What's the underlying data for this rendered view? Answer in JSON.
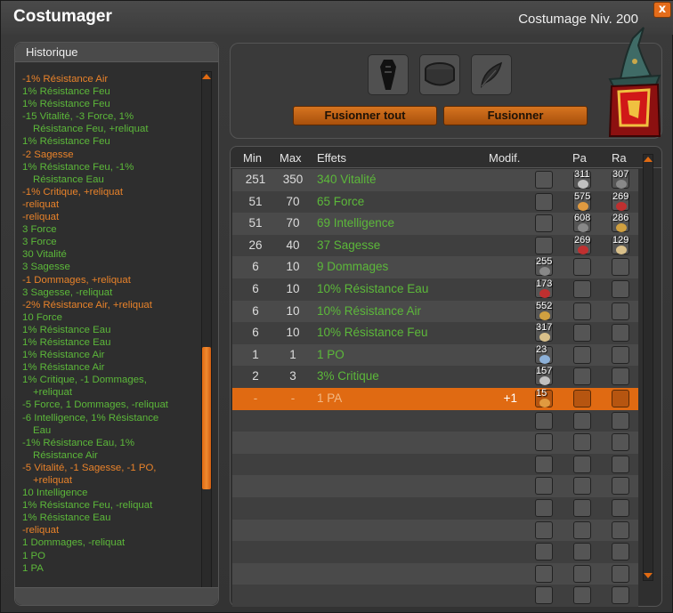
{
  "window": {
    "title": "Costumager",
    "subtitle": "Costumage Niv. 200",
    "close_label": "x"
  },
  "history": {
    "title": "Historique",
    "lines": [
      {
        "text": "-1% Résistance Air",
        "color": "orange"
      },
      {
        "text": "1% Résistance Feu",
        "color": "green"
      },
      {
        "text": "1% Résistance Feu",
        "color": "green"
      },
      {
        "text": "-15 Vitalité, -3 Force, 1%",
        "color": "green"
      },
      {
        "text": "Résistance Feu, +reliquat",
        "color": "green",
        "cont": true
      },
      {
        "text": "1% Résistance Feu",
        "color": "green"
      },
      {
        "text": "-2 Sagesse",
        "color": "orange"
      },
      {
        "text": "1% Résistance Feu, -1%",
        "color": "green"
      },
      {
        "text": "Résistance Eau",
        "color": "green",
        "cont": true
      },
      {
        "text": "-1% Critique, +reliquat",
        "color": "orange"
      },
      {
        "text": "-reliquat",
        "color": "orange"
      },
      {
        "text": "-reliquat",
        "color": "orange"
      },
      {
        "text": "3 Force",
        "color": "green"
      },
      {
        "text": "3 Force",
        "color": "green"
      },
      {
        "text": "30 Vitalité",
        "color": "green"
      },
      {
        "text": "3 Sagesse",
        "color": "green"
      },
      {
        "text": "-1 Dommages, +reliquat",
        "color": "orange"
      },
      {
        "text": "3 Sagesse, -reliquat",
        "color": "green"
      },
      {
        "text": "-2% Résistance Air, +reliquat",
        "color": "orange"
      },
      {
        "text": "10 Force",
        "color": "green"
      },
      {
        "text": "1% Résistance Eau",
        "color": "green"
      },
      {
        "text": "1% Résistance Eau",
        "color": "green"
      },
      {
        "text": "1% Résistance Air",
        "color": "green"
      },
      {
        "text": "1% Résistance Air",
        "color": "green"
      },
      {
        "text": "1% Critique, -1 Dommages,",
        "color": "green"
      },
      {
        "text": "+reliquat",
        "color": "green",
        "cont": true
      },
      {
        "text": "-5 Force, 1 Dommages, -reliquat",
        "color": "green"
      },
      {
        "text": "-6 Intelligence, 1% Résistance",
        "color": "green"
      },
      {
        "text": "Eau",
        "color": "green",
        "cont": true
      },
      {
        "text": "-1% Résistance Eau, 1%",
        "color": "green"
      },
      {
        "text": "Résistance Air",
        "color": "green",
        "cont": true
      },
      {
        "text": "-5 Vitalité, -1 Sagesse, -1 PO,",
        "color": "orange"
      },
      {
        "text": "+reliquat",
        "color": "orange",
        "cont": true
      },
      {
        "text": "10 Intelligence",
        "color": "green"
      },
      {
        "text": "1% Résistance Feu, -reliquat",
        "color": "green"
      },
      {
        "text": "1% Résistance Eau",
        "color": "green"
      },
      {
        "text": "-reliquat",
        "color": "orange"
      },
      {
        "text": "1 Dommages, -reliquat",
        "color": "green"
      },
      {
        "text": "1 PO",
        "color": "green"
      },
      {
        "text": "1 PA",
        "color": "green"
      }
    ],
    "scroll_fraction": 0.72
  },
  "fusion": {
    "slots": [
      "mask-icon",
      "rune-box-icon",
      "feather-icon"
    ],
    "fuse_all_label": "Fusionner tout",
    "fuse_label": "Fusionner"
  },
  "table": {
    "headers": {
      "min": "Min",
      "max": "Max",
      "effects": "Effets",
      "modif": "Modif.",
      "pa": "Pa",
      "ra": "Ra"
    },
    "rows": [
      {
        "min": "251",
        "max": "350",
        "effect": "340 Vitalité",
        "modif": "",
        "rune": null,
        "pa": "311",
        "ra": "307"
      },
      {
        "min": "51",
        "max": "70",
        "effect": "65 Force",
        "modif": "",
        "rune": null,
        "pa": "575",
        "ra": "269"
      },
      {
        "min": "51",
        "max": "70",
        "effect": "69 Intelligence",
        "modif": "",
        "rune": null,
        "pa": "608",
        "ra": "286"
      },
      {
        "min": "26",
        "max": "40",
        "effect": "37 Sagesse",
        "modif": "",
        "rune": null,
        "pa": "269",
        "ra": "129"
      },
      {
        "min": "6",
        "max": "10",
        "effect": "9 Dommages",
        "modif": "",
        "rune": "255",
        "pa": null,
        "ra": null
      },
      {
        "min": "6",
        "max": "10",
        "effect": "10% Résistance Eau",
        "modif": "",
        "rune": "173",
        "pa": null,
        "ra": null
      },
      {
        "min": "6",
        "max": "10",
        "effect": "10% Résistance Air",
        "modif": "",
        "rune": "552",
        "pa": null,
        "ra": null
      },
      {
        "min": "6",
        "max": "10",
        "effect": "10% Résistance Feu",
        "modif": "",
        "rune": "317",
        "pa": null,
        "ra": null
      },
      {
        "min": "1",
        "max": "1",
        "effect": "1 PO",
        "modif": "",
        "rune": "23",
        "pa": null,
        "ra": null
      },
      {
        "min": "2",
        "max": "3",
        "effect": "3% Critique",
        "modif": "",
        "rune": "157",
        "pa": null,
        "ra": null
      },
      {
        "min": "-",
        "max": "-",
        "effect": "1 PA",
        "modif": "+1",
        "rune": "15",
        "pa": null,
        "ra": null,
        "selected": true
      }
    ],
    "empty_rows": 9
  },
  "colors": {
    "accent": "#e06a12",
    "positive": "#5cb83a",
    "negative": "#e8822a"
  }
}
